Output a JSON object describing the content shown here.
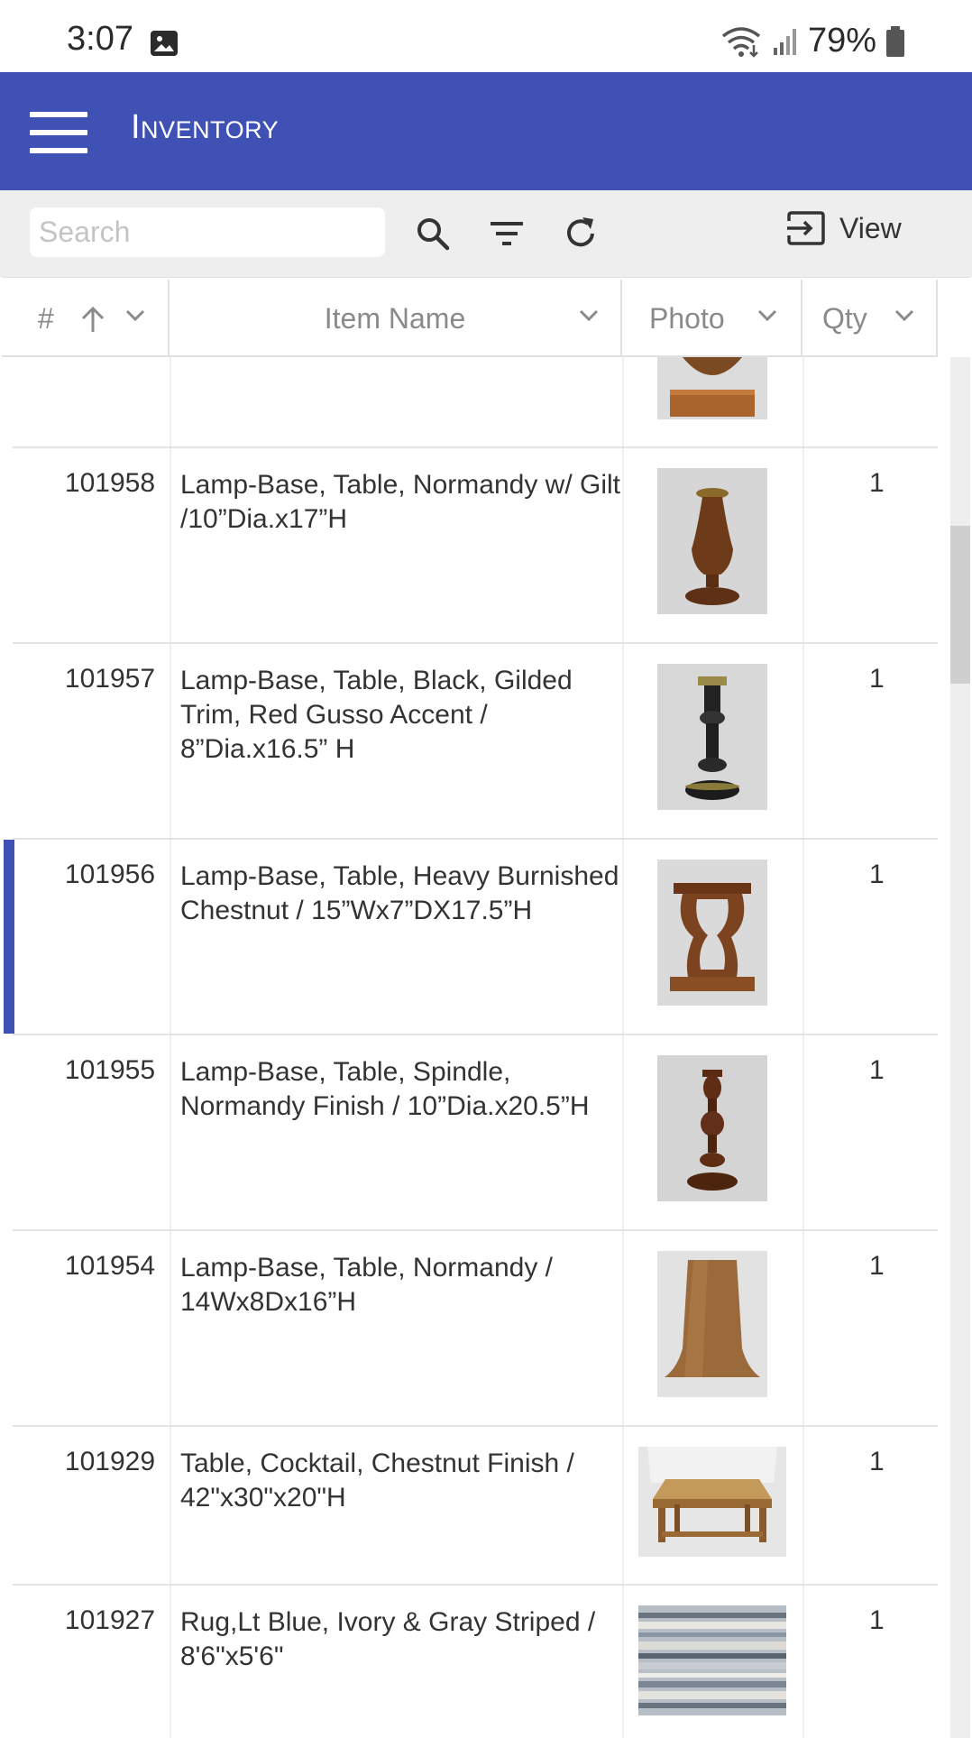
{
  "status_bar": {
    "time": "3:07",
    "battery": "79%"
  },
  "app_bar": {
    "title": "Inventory"
  },
  "toolbar": {
    "search_placeholder": "Search",
    "search_value": "",
    "view_label": "View"
  },
  "table": {
    "columns": [
      "#",
      "Item Name",
      "Photo",
      "Qty"
    ],
    "rows": [
      {
        "num": "",
        "name": "",
        "qty": "",
        "photo": "lamp-base-partial"
      },
      {
        "num": "101958",
        "name": "Lamp-Base, Table, Normandy w/ Gilt /10”Dia.x17”H",
        "qty": "1",
        "photo": "turned-wood-lamp-base"
      },
      {
        "num": "101957",
        "name": "Lamp-Base, Table, Black, Gilded Trim, Red Gusso Accent / 8”Dia.x16.5” H",
        "qty": "1",
        "photo": "black-gilded-lamp-base"
      },
      {
        "num": "101956",
        "name": "Lamp-Base, Table, Heavy Burnished Chestnut / 15”Wx7”DX17.5”H",
        "qty": "1",
        "photo": "lyre-lamp-base"
      },
      {
        "num": "101955",
        "name": "Lamp-Base, Table, Spindle, Normandy Finish / 10”Dia.x20.5”H",
        "qty": "1",
        "photo": "spindle-lamp-base"
      },
      {
        "num": "101954",
        "name": "Lamp-Base, Table, Normandy / 14Wx8Dx16”H",
        "qty": "1",
        "photo": "tapered-wood-lamp-base"
      },
      {
        "num": "101929",
        "name": "Table, Cocktail, Chestnut Finish / 42\"x30\"x20\"H",
        "qty": "1",
        "photo": "cocktail-table"
      },
      {
        "num": "101927",
        "name": "Rug,Lt Blue, Ivory & Gray Striped / 8'6\"x5'6\"",
        "qty": "1",
        "photo": "striped-rug"
      }
    ]
  },
  "colors": {
    "primary": "#3f51b5",
    "toolbar_bg": "#eeeeee",
    "text": "#333333",
    "muted": "#8a8a8a"
  }
}
